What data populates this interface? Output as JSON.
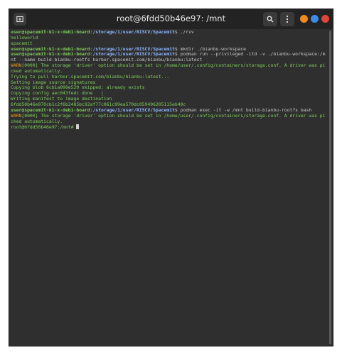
{
  "window": {
    "title": "root@6fdd50b46e97: /mnt",
    "colors": {
      "close": "#e0443a",
      "maximize": "#3c8ce7",
      "minimize": "#f08a1c"
    }
  },
  "terminal": {
    "lines": [
      {
        "type": "prompt",
        "user": "user@spacemit-k1-x-deb1-board",
        "sep": ":",
        "path": "/storage/1/user/RISCV/Spacemit",
        "suffix": "$ ",
        "cmd": "./rvv"
      },
      {
        "type": "out",
        "text": "helloworld"
      },
      {
        "type": "out",
        "text": "spacemit"
      },
      {
        "type": "prompt",
        "user": "user@spacemit-k1-x-deb1-board",
        "sep": ":",
        "path": "/storage/1/user/RISCV/Spacemit",
        "suffix": "$ ",
        "cmd": "mkdir ./bianbu-workspace"
      },
      {
        "type": "prompt",
        "user": "user@spacemit-k1-x-deb1-board",
        "sep": ":",
        "path": "/storage/1/user/RISCV/Spacemit",
        "suffix": "$ ",
        "cmd": "podman run --privileged -itd -v ./bianbu-workspace:/mnt --name build-bianbu-rootfs harbor.spacemit.com/bianbu/bianbu:latest"
      },
      {
        "type": "warn",
        "tag": "WARN",
        "text": "[0000] The storage 'driver' option should be set in /home/user/.config/containers/storage.conf. A driver was picked automatically."
      },
      {
        "type": "out",
        "text": "Trying to pull harbor.spacemit.com/bianbu/bianbu:latest..."
      },
      {
        "type": "out",
        "text": "Getting image source signatures"
      },
      {
        "type": "out",
        "text": "Copying blob 6cb1a090e520 skipped: already exists"
      },
      {
        "type": "out",
        "text": "Copying config aec043fedc done   |"
      },
      {
        "type": "out",
        "text": "Writing manifest to image destination"
      },
      {
        "type": "out",
        "text": "6fdd50b46e970cb1c2f6b2485bc92af77c061c99ea570dc059496205115eb40c"
      },
      {
        "type": "prompt",
        "user": "user@spacemit-k1-x-deb1-board",
        "sep": ":",
        "path": "/storage/1/user/RISCV/Spacemit",
        "suffix": "$ ",
        "cmd": "podman exec -it -w /mnt build-bianbu-rootfs bash"
      },
      {
        "type": "warn",
        "tag": "WARN",
        "text": "[0000] The storage 'driver' option should be set in /home/user/.config/containers/storage.conf. A driver was picked automatically."
      },
      {
        "type": "rootprompt",
        "text": "root@6fdd50b46e97:/mnt# "
      }
    ]
  }
}
